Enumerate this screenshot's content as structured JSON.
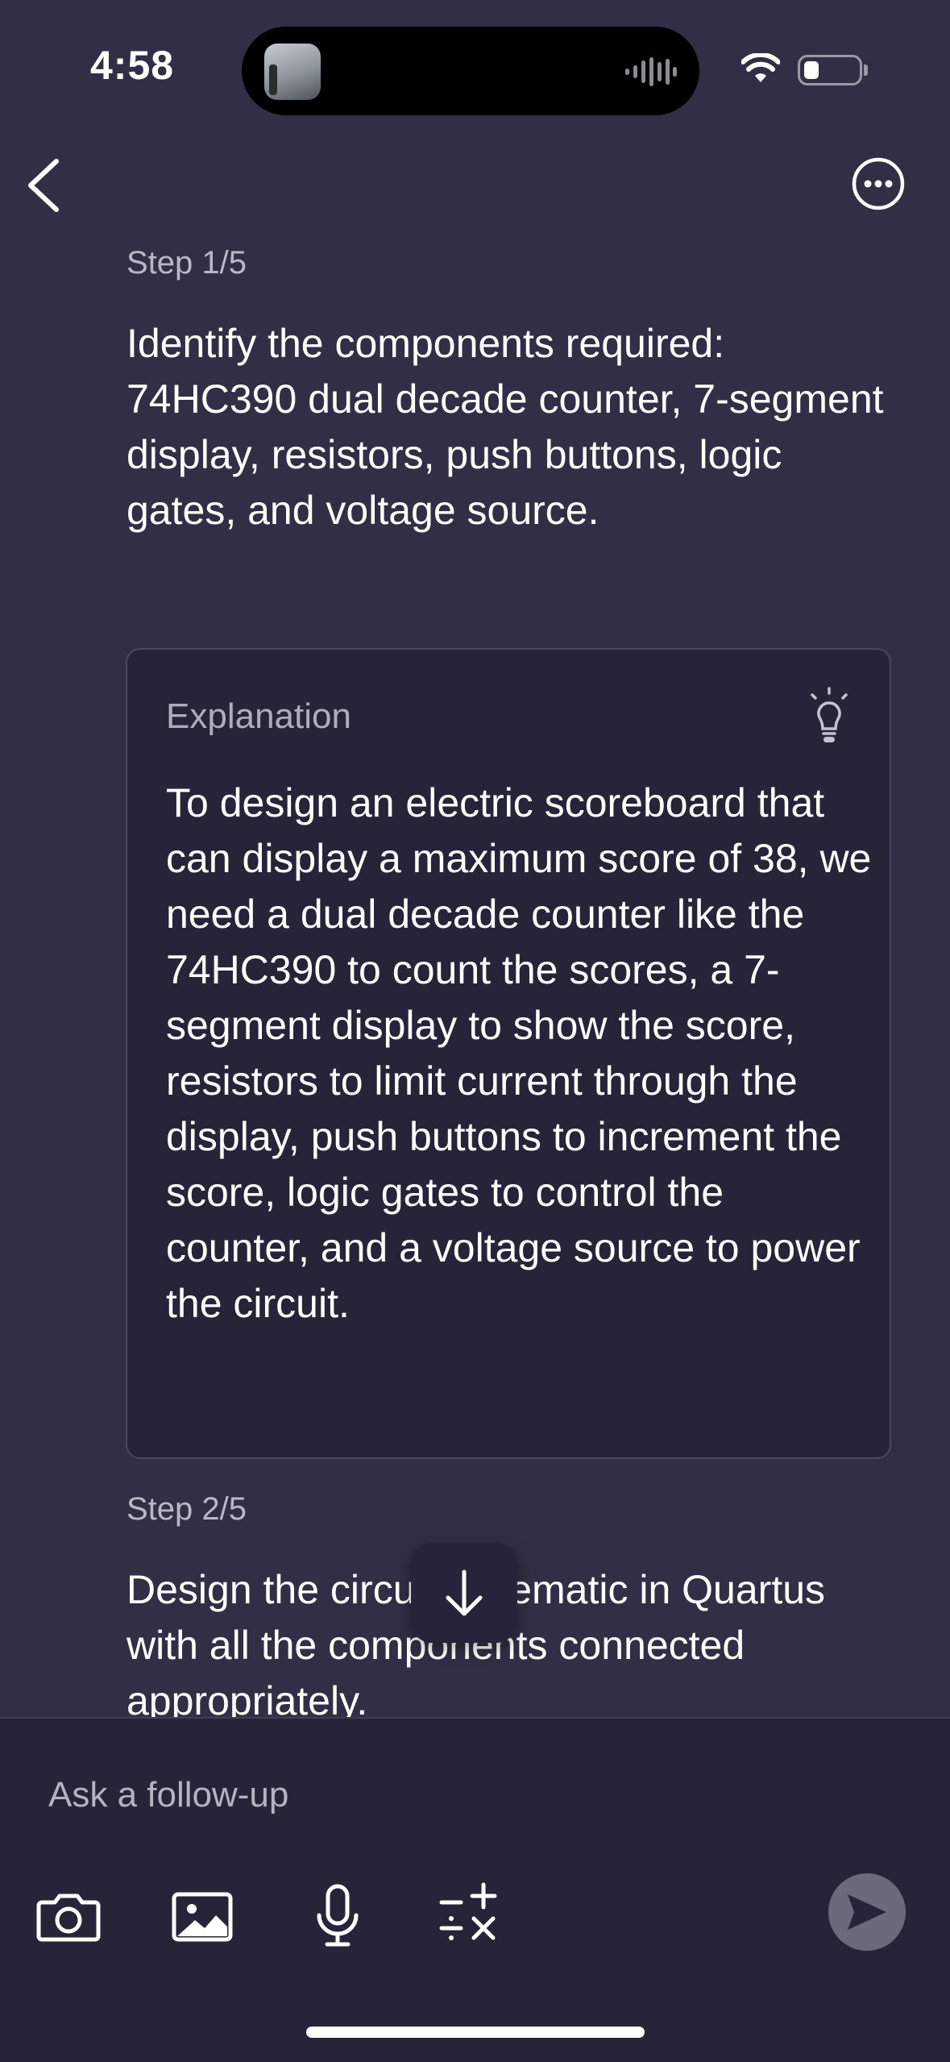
{
  "status_bar": {
    "time": "4:58"
  },
  "steps": [
    {
      "label": "Step 1/5",
      "text": "Identify the components required: 74HC390 dual decade counter, 7-segment display, resistors, push buttons, logic gates, and voltage source."
    },
    {
      "label": "Step 2/5",
      "text": "Design the circuit schematic in Quartus with all the components connected appropriately."
    }
  ],
  "explanation": {
    "title": "Explanation",
    "text": "To design an electric scoreboard that can display a maximum score of 38, we need a dual decade counter like the 74HC390 to count the scores, a 7-segment display to show the score, resistors to limit current through the display, push buttons to increment the score, logic gates to control the counter, and a voltage source to power the circuit."
  },
  "followup": {
    "placeholder": "Ask a follow-up"
  },
  "colors": {
    "background": "#302f45",
    "card": "#262438",
    "send_button": "#6b6a7d"
  },
  "icons": {
    "back": "chevron-left-icon",
    "more": "ellipsis-circle-icon",
    "hint": "lightbulb-icon",
    "scroll": "arrow-down-icon",
    "camera": "camera-icon",
    "image": "image-icon",
    "mic": "microphone-icon",
    "math": "math-operators-icon",
    "send": "send-icon"
  }
}
